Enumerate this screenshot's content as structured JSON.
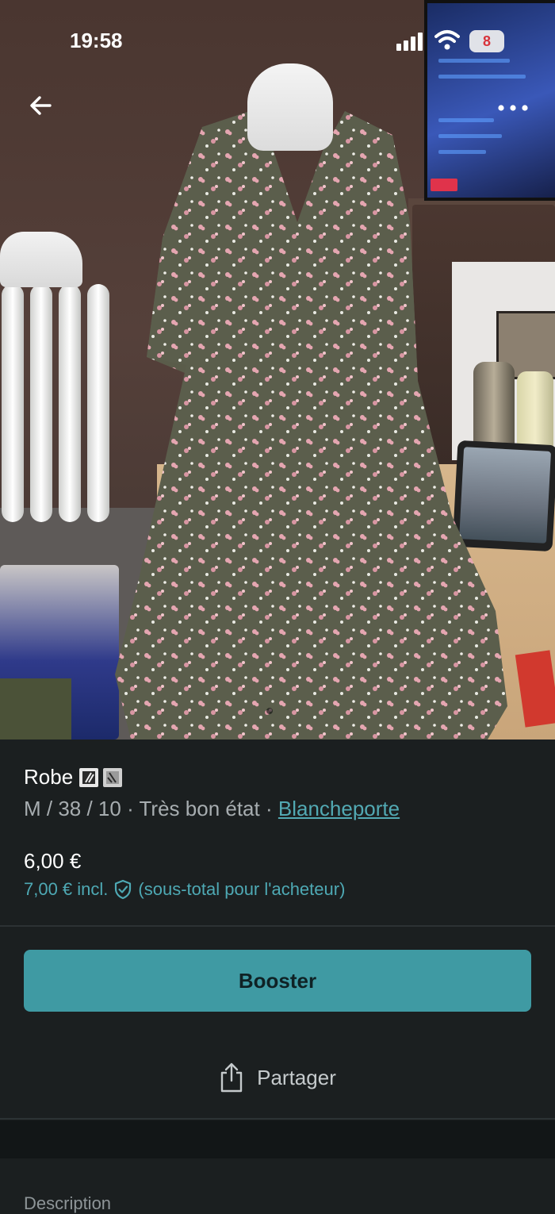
{
  "status_bar": {
    "time": "19:58",
    "battery": "8",
    "icons": [
      "signal-icon",
      "wifi-icon",
      "battery-icon"
    ]
  },
  "top_nav": {
    "back_icon": "arrow-left-icon",
    "more_icon": "more-horizontal-icon"
  },
  "item": {
    "title": "Robe",
    "title_badges": [
      "slash-badge-icon",
      "slash-badge-icon"
    ],
    "size": "M / 38 / 10",
    "separator": "·",
    "condition": "Très bon état",
    "brand": "Blancheporte",
    "price": "6,00 €",
    "price_incl_prefix": "7,00 € incl.",
    "price_incl_suffix": "(sous-total pour l'acheteur)"
  },
  "actions": {
    "booster_label": "Booster",
    "share_label": "Partager"
  },
  "description": {
    "label": "Description"
  },
  "colors": {
    "background": "#1b1f20",
    "accent": "#3f9aa3",
    "link": "#52a9b3",
    "muted_text": "#a7adb0"
  }
}
